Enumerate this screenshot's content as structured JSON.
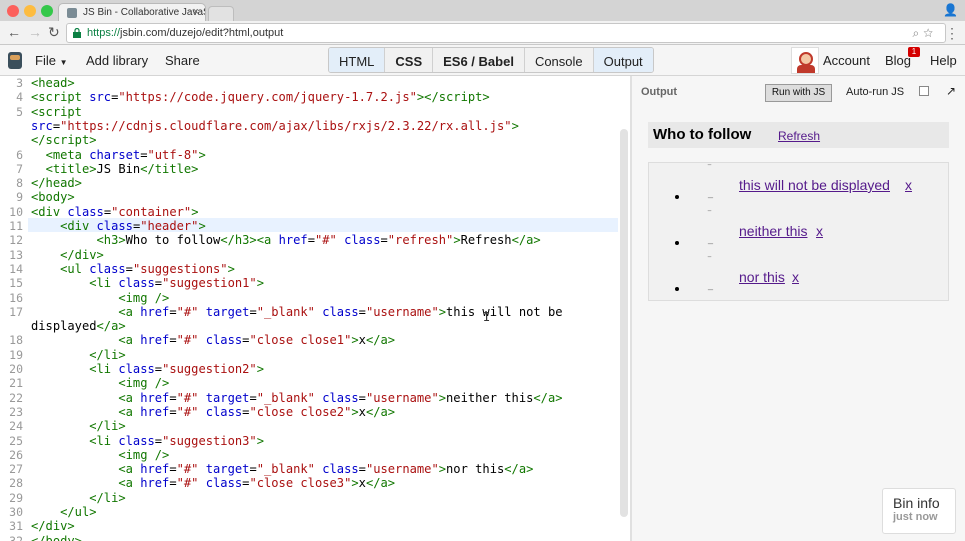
{
  "browser": {
    "tab_title": "JS Bin - Collaborative JavaS",
    "url_scheme": "https://",
    "url_rest": "jsbin.com/duzejo/edit?html,output"
  },
  "header": {
    "file_label": "File",
    "add_library_label": "Add library",
    "share_label": "Share",
    "panels": [
      {
        "label": "HTML",
        "active": true,
        "bold": false
      },
      {
        "label": "CSS",
        "active": false,
        "bold": true
      },
      {
        "label": "ES6 / Babel",
        "active": false,
        "bold": true
      },
      {
        "label": "Console",
        "active": false,
        "bold": false
      },
      {
        "label": "Output",
        "active": true,
        "bold": false
      }
    ],
    "account_label": "Account",
    "blog_label": "Blog",
    "blog_badge": "1",
    "help_label": "Help"
  },
  "editor": {
    "lines": [
      {
        "num": "3",
        "html": "<span class=\"tag\">&lt;head&gt;</span>"
      },
      {
        "num": "4",
        "html": "<span class=\"tag\">&lt;script</span> <span class=\"a\">src</span>=<span class=\"s\">\"https://code.jquery.com/jquery-1.7.2.js\"</span><span class=\"tag\">&gt;&lt;/script&gt;</span>"
      },
      {
        "num": "5",
        "html": "<span class=\"tag\">&lt;script</span>"
      },
      {
        "num": "",
        "html": "<span class=\"a\">src</span>=<span class=\"s\">\"https://cdnjs.cloudflare.com/ajax/libs/rxjs/2.3.22/rx.all.js\"</span><span class=\"tag\">&gt;</span>"
      },
      {
        "num": "",
        "html": "<span class=\"tag\">&lt;/script&gt;</span>"
      },
      {
        "num": "6",
        "html": "  <span class=\"tag\">&lt;meta</span> <span class=\"a\">charset</span>=<span class=\"s\">\"utf-8\"</span><span class=\"tag\">&gt;</span>"
      },
      {
        "num": "7",
        "html": "  <span class=\"tag\">&lt;title&gt;</span>JS Bin<span class=\"tag\">&lt;/title&gt;</span>"
      },
      {
        "num": "8",
        "html": "<span class=\"tag\">&lt;/head&gt;</span>"
      },
      {
        "num": "9",
        "html": "<span class=\"tag\">&lt;body&gt;</span>"
      },
      {
        "num": "10",
        "html": "<span class=\"tag\">&lt;div</span> <span class=\"a\">class</span>=<span class=\"s\">\"container\"</span><span class=\"tag\">&gt;</span>"
      },
      {
        "num": "11",
        "html": "    <span class=\"tag\">&lt;div</span> <span class=\"a\">class</span>=<span class=\"s\">\"header\"</span><span class=\"tag\">&gt;</span>"
      },
      {
        "num": "12",
        "html": "         <span class=\"tag\">&lt;h3&gt;</span>Who to follow<span class=\"tag\">&lt;/h3&gt;&lt;a</span> <span class=\"a\">href</span>=<span class=\"s\">\"#\"</span> <span class=\"a\">class</span>=<span class=\"s\">\"refresh\"</span><span class=\"tag\">&gt;</span>Refresh<span class=\"tag\">&lt;/a&gt;</span>"
      },
      {
        "num": "13",
        "html": "    <span class=\"tag\">&lt;/div&gt;</span>"
      },
      {
        "num": "14",
        "html": "    <span class=\"tag\">&lt;ul</span> <span class=\"a\">class</span>=<span class=\"s\">\"suggestions\"</span><span class=\"tag\">&gt;</span>"
      },
      {
        "num": "15",
        "html": "        <span class=\"tag\">&lt;li</span> <span class=\"a\">class</span>=<span class=\"s\">\"suggestion1\"</span><span class=\"tag\">&gt;</span>"
      },
      {
        "num": "16",
        "html": "            <span class=\"tag\">&lt;img /&gt;</span>"
      },
      {
        "num": "17",
        "html": "            <span class=\"tag\">&lt;a</span> <span class=\"a\">href</span>=<span class=\"s\">\"#\"</span> <span class=\"a\">target</span>=<span class=\"s\">\"_blank\"</span> <span class=\"a\">class</span>=<span class=\"s\">\"username\"</span><span class=\"tag\">&gt;</span>this will not be"
      },
      {
        "num": "",
        "html": "displayed<span class=\"tag\">&lt;/a&gt;</span>"
      },
      {
        "num": "18",
        "html": "            <span class=\"tag\">&lt;a</span> <span class=\"a\">href</span>=<span class=\"s\">\"#\"</span> <span class=\"a\">class</span>=<span class=\"s\">\"close close1\"</span><span class=\"tag\">&gt;</span>x<span class=\"tag\">&lt;/a&gt;</span>"
      },
      {
        "num": "19",
        "html": "        <span class=\"tag\">&lt;/li&gt;</span>"
      },
      {
        "num": "20",
        "html": "        <span class=\"tag\">&lt;li</span> <span class=\"a\">class</span>=<span class=\"s\">\"suggestion2\"</span><span class=\"tag\">&gt;</span>"
      },
      {
        "num": "21",
        "html": "            <span class=\"tag\">&lt;img /&gt;</span>"
      },
      {
        "num": "22",
        "html": "            <span class=\"tag\">&lt;a</span> <span class=\"a\">href</span>=<span class=\"s\">\"#\"</span> <span class=\"a\">target</span>=<span class=\"s\">\"_blank\"</span> <span class=\"a\">class</span>=<span class=\"s\">\"username\"</span><span class=\"tag\">&gt;</span>neither this<span class=\"tag\">&lt;/a&gt;</span>"
      },
      {
        "num": "23",
        "html": "            <span class=\"tag\">&lt;a</span> <span class=\"a\">href</span>=<span class=\"s\">\"#\"</span> <span class=\"a\">class</span>=<span class=\"s\">\"close close2\"</span><span class=\"tag\">&gt;</span>x<span class=\"tag\">&lt;/a&gt;</span>"
      },
      {
        "num": "24",
        "html": "        <span class=\"tag\">&lt;/li&gt;</span>"
      },
      {
        "num": "25",
        "html": "        <span class=\"tag\">&lt;li</span> <span class=\"a\">class</span>=<span class=\"s\">\"suggestion3\"</span><span class=\"tag\">&gt;</span>"
      },
      {
        "num": "26",
        "html": "            <span class=\"tag\">&lt;img /&gt;</span>"
      },
      {
        "num": "27",
        "html": "            <span class=\"tag\">&lt;a</span> <span class=\"a\">href</span>=<span class=\"s\">\"#\"</span> <span class=\"a\">target</span>=<span class=\"s\">\"_blank\"</span> <span class=\"a\">class</span>=<span class=\"s\">\"username\"</span><span class=\"tag\">&gt;</span>nor this<span class=\"tag\">&lt;/a&gt;</span>"
      },
      {
        "num": "28",
        "html": "            <span class=\"tag\">&lt;a</span> <span class=\"a\">href</span>=<span class=\"s\">\"#\"</span> <span class=\"a\">class</span>=<span class=\"s\">\"close close3\"</span><span class=\"tag\">&gt;</span>x<span class=\"tag\">&lt;/a&gt;</span>"
      },
      {
        "num": "29",
        "html": "        <span class=\"tag\">&lt;/li&gt;</span>"
      },
      {
        "num": "30",
        "html": "    <span class=\"tag\">&lt;/ul&gt;</span>"
      },
      {
        "num": "31",
        "html": "<span class=\"tag\">&lt;/div&gt;</span>"
      },
      {
        "num": "32",
        "html": "<span class=\"tag\">&lt;/body&gt;</span>"
      }
    ]
  },
  "output_panel": {
    "label": "Output",
    "run_button": "Run with JS",
    "autorun_label": "Auto-run JS",
    "autorun_checked": false,
    "follow_title": "Who to follow",
    "refresh_label": "Refresh",
    "suggestions": [
      {
        "username": "this will not be displayed",
        "close": "x"
      },
      {
        "username": "neither this",
        "close": "x"
      },
      {
        "username": "nor this",
        "close": "x"
      }
    ]
  },
  "bin_info": {
    "title": "Bin info",
    "subtitle": "just now"
  }
}
